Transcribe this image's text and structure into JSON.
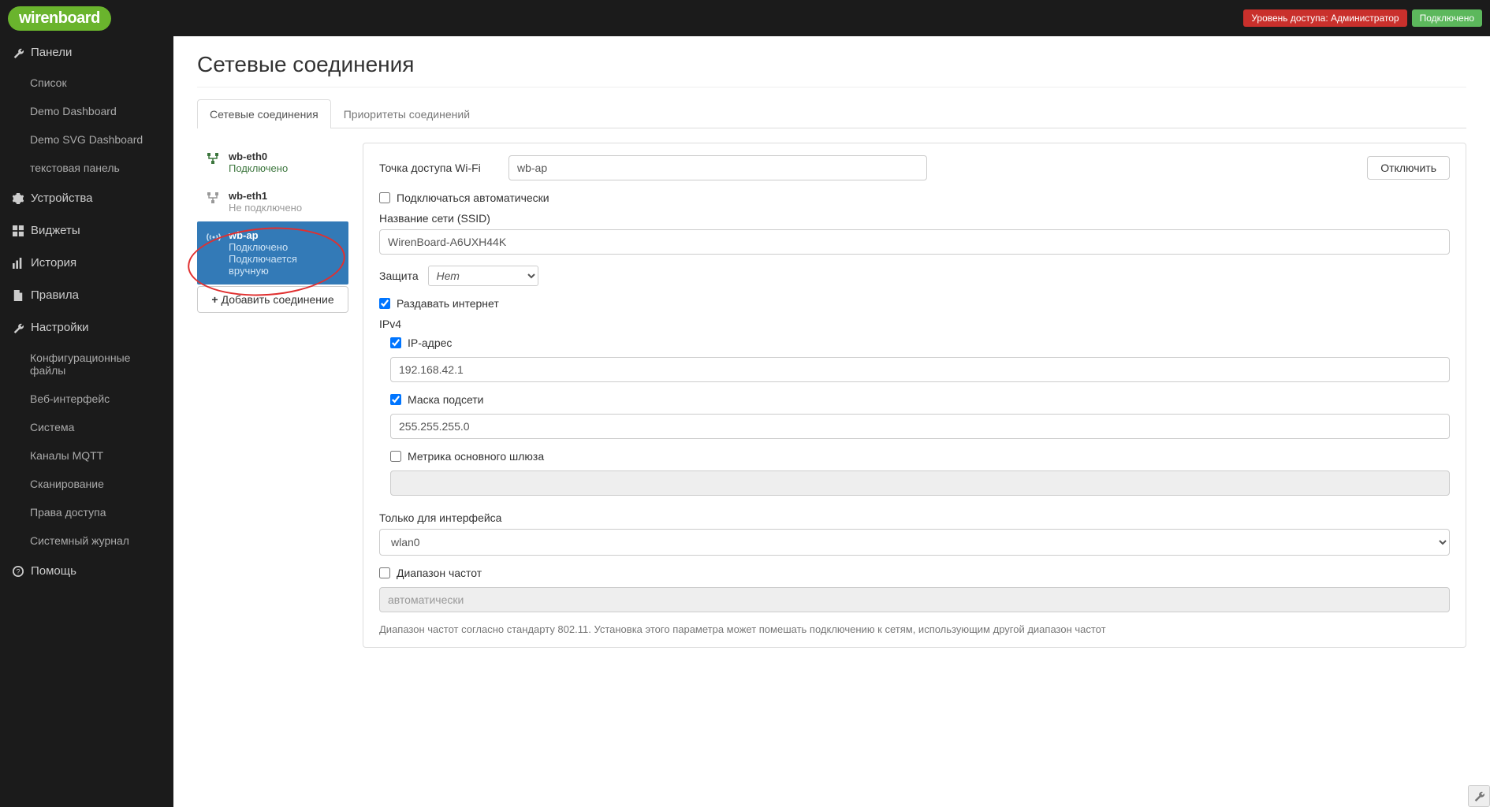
{
  "header": {
    "logo": "wirenboard",
    "access_level_label": "Уровень доступа: Администратор",
    "connection_status": "Подключено"
  },
  "sidebar": {
    "panels": {
      "label": "Панели",
      "items": [
        "Список",
        "Demo Dashboard",
        "Demo SVG Dashboard",
        "текстовая панель"
      ]
    },
    "devices": {
      "label": "Устройства"
    },
    "widgets": {
      "label": "Виджеты"
    },
    "history": {
      "label": "История"
    },
    "rules": {
      "label": "Правила"
    },
    "settings": {
      "label": "Настройки",
      "items": [
        "Конфигурационные файлы",
        "Веб-интерфейс",
        "Система",
        "Каналы MQTT",
        "Сканирование",
        "Права доступа",
        "Системный журнал"
      ]
    },
    "help": {
      "label": "Помощь"
    }
  },
  "page": {
    "title": "Сетевые соединения",
    "tabs": [
      "Сетевые соединения",
      "Приоритеты соединений"
    ]
  },
  "connections": [
    {
      "name": "wb-eth0",
      "status": "Подключено",
      "type": "ethernet",
      "state": "green"
    },
    {
      "name": "wb-eth1",
      "status": "Не подключено",
      "type": "ethernet",
      "state": "gray"
    },
    {
      "name": "wb-ap",
      "status": "Подключено",
      "status2": "Подключается вручную",
      "type": "wifi",
      "state": "selected"
    }
  ],
  "add_connection_label": "Добавить соединение",
  "form": {
    "type_label": "Точка доступа Wi-Fi",
    "name_value": "wb-ap",
    "disconnect_btn": "Отключить",
    "auto_connect_label": "Подключаться автоматически",
    "ssid_label": "Название сети (SSID)",
    "ssid_value": "WirenBoard-A6UXH44K",
    "security_label": "Защита",
    "security_value": "Нет",
    "share_internet_label": "Раздавать интернет",
    "ipv4_heading": "IPv4",
    "ip_label": "IP-адрес",
    "ip_value": "192.168.42.1",
    "mask_label": "Маска подсети",
    "mask_value": "255.255.255.0",
    "gateway_metric_label": "Метрика основного шлюза",
    "interface_label": "Только для интерфейса",
    "interface_value": "wlan0",
    "freq_range_label": "Диапазон частот",
    "freq_range_value": "автоматически",
    "freq_help": "Диапазон частот согласно стандарту 802.11. Установка этого параметра может помешать подключению к сетям, использующим другой диапазон частот"
  }
}
